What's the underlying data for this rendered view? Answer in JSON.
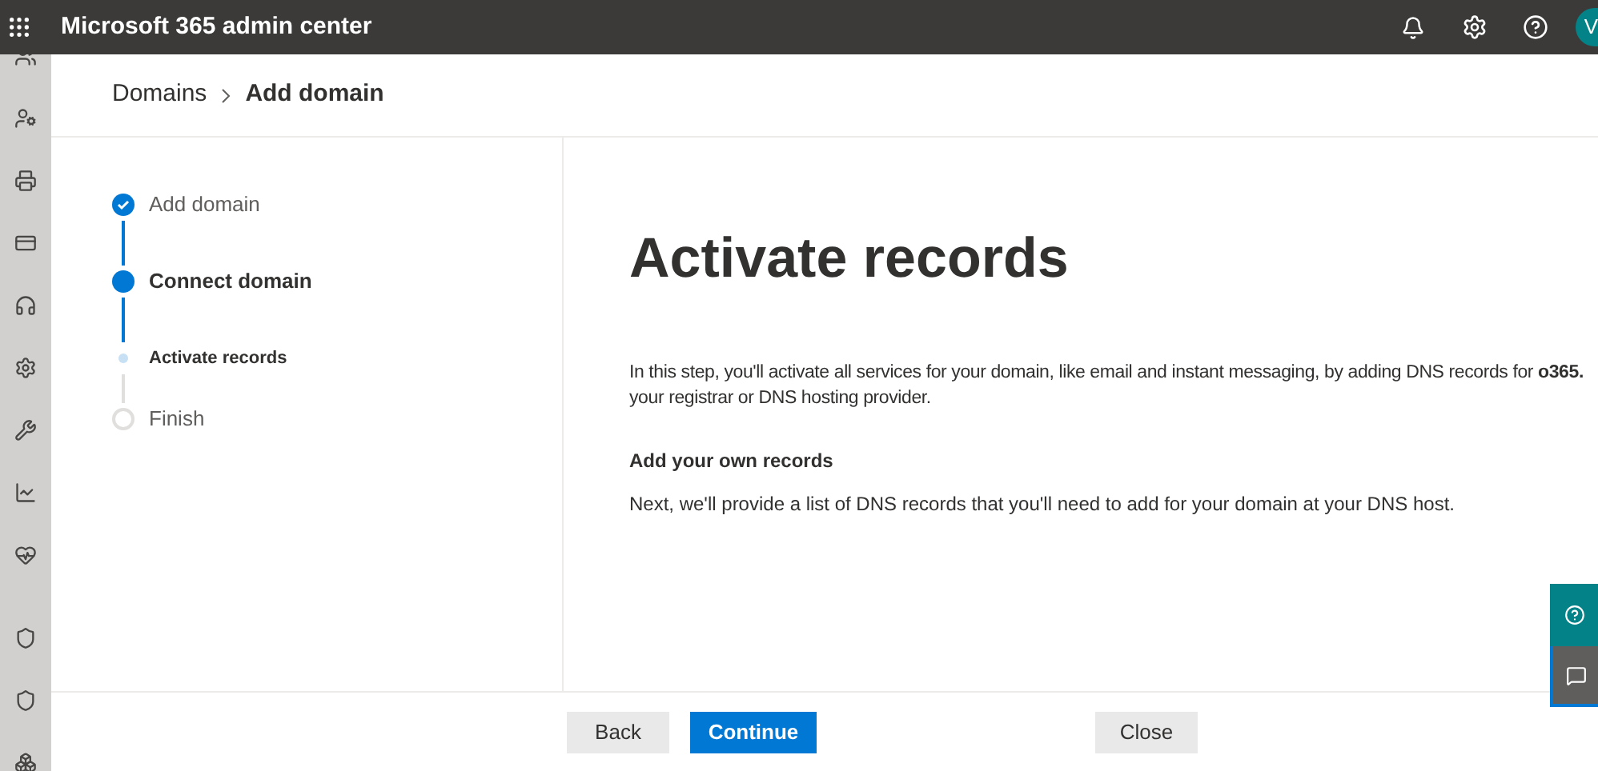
{
  "app_title": "Microsoft 365 admin center",
  "avatar": {
    "initial": "V"
  },
  "breadcrumb": [
    "Domains",
    "Add domain"
  ],
  "steps": [
    {
      "label": "Add domain",
      "kind": "completed"
    },
    {
      "label": "Connect domain",
      "kind": "current"
    },
    {
      "label": "Activate records",
      "kind": "substep"
    },
    {
      "label": "Finish",
      "kind": "pending"
    }
  ],
  "heading": "Activate records",
  "intro_lines": [
    "In this step, you'll activate all services for your domain, like email and instant messaging, by adding DNS records for **o365.**",
    "your registrar or DNS hosting provider."
  ],
  "section_title": "Add your own records",
  "section_text": "Next, we'll provide a list of DNS records that you'll need to add for your domain at your DNS host.",
  "buttons": [
    {
      "label": "Back",
      "kind": "secondary"
    },
    {
      "label": "Continue",
      "kind": "primary"
    },
    {
      "label": "Close",
      "kind": "secondary"
    }
  ]
}
